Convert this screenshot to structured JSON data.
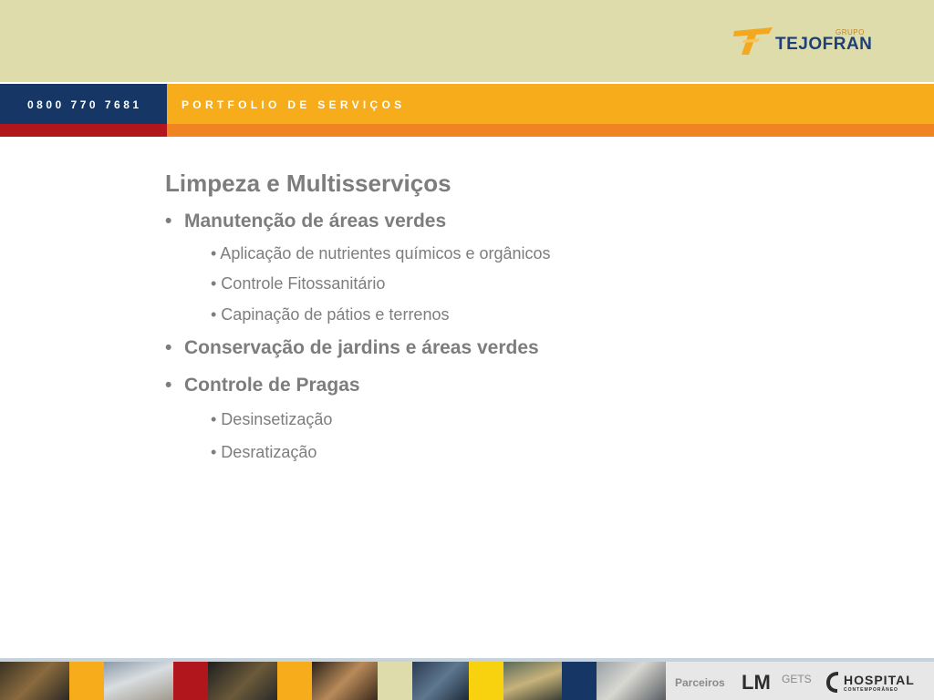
{
  "header": {
    "logo": {
      "group": "GRUPO",
      "brand": "TEJOFRAN"
    },
    "phone": "0800 770 7681",
    "section": "PORTFOLIO DE SERVIÇOS"
  },
  "slide": {
    "title": "Limpeza e Multisserviços",
    "items": [
      {
        "bullet": "•",
        "label": "Manutenção de áreas verdes",
        "subitems": [
          "• Aplicação de nutrientes químicos e orgânicos",
          "• Controle Fitossanitário",
          "• Capinação de pátios e terrenos"
        ]
      },
      {
        "bullet": "•",
        "label": "Conservação de jardins e áreas verdes",
        "subitems": []
      },
      {
        "bullet": "•",
        "label": "Controle de Pragas",
        "subitems": [
          "• Desinsetização",
          "• Desratização"
        ]
      }
    ]
  },
  "footer": {
    "partners_label": "Parceiros",
    "partners": {
      "lm": "LM",
      "gets": "GETS",
      "hospital": "HOSPITAL",
      "hospital_sub": "CONTEMPORÂNEO"
    }
  },
  "colors": {
    "top_band": "#dedcaa",
    "navy": "#163766",
    "orange": "#f6ac1b",
    "red": "#b1161c",
    "dark_orange": "#f08421",
    "text_gray": "#7d7d7d"
  }
}
